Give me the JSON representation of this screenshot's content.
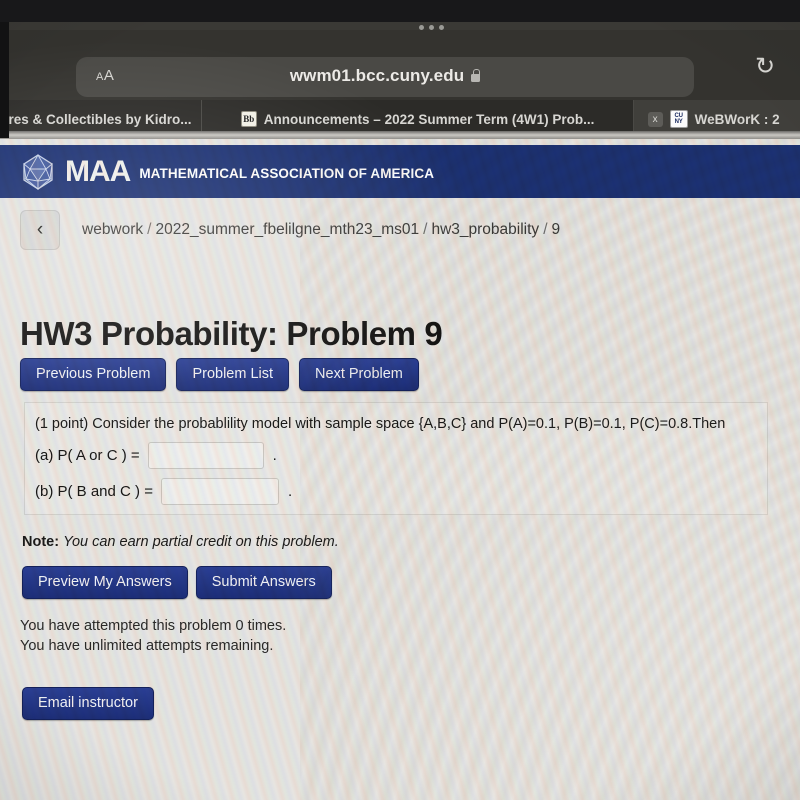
{
  "browser": {
    "tab_overflow_icon": "ellipsis-icon",
    "text_size_button": "AA",
    "url": "wwm01.bcc.cuny.edu",
    "lock_icon": "lock-icon",
    "reload_icon": "reload-icon",
    "tabs": [
      {
        "title": "gures & Collectibles by Kidro...",
        "favicon": "none",
        "active": false,
        "has_close": false
      },
      {
        "title": "Announcements – 2022 Summer Term (4W1) Prob...",
        "favicon": "blackboard-icon",
        "favicon_text": "Bb",
        "active": false,
        "has_close": false
      },
      {
        "title": "WeBWorK : 2",
        "favicon": "cuny-icon",
        "favicon_line1": "CU",
        "favicon_line2": "NY",
        "active": true,
        "has_close": true,
        "close_label": "x"
      }
    ]
  },
  "site_header": {
    "logo_name": "maa-icosahedron-logo",
    "brand": "MAA",
    "brand_subtitle": "MATHEMATICAL ASSOCIATION OF AMERICA",
    "banner_color": "#1c3173"
  },
  "breadcrumb": {
    "back_icon": "chevron-left-icon",
    "separator": "/",
    "items": [
      "webwork",
      "2022_summer_fbelilgne_mth23_ms01",
      "hw3_probability",
      "9"
    ]
  },
  "main": {
    "title": "HW3 Probability: Problem 9",
    "nav_buttons": [
      "Previous Problem",
      "Problem List",
      "Next Problem"
    ],
    "problem": {
      "statement": "(1 point) Consider the probablility model with sample space {A,B,C} and P(A)=0.1, P(B)=0.1, P(C)=0.8.Then",
      "parts": [
        {
          "label": "(a) P( A or C ) =",
          "value": "",
          "placeholder": "",
          "trailing": "."
        },
        {
          "label": "(b) P( B and C ) =",
          "value": "",
          "placeholder": "",
          "trailing": "."
        }
      ]
    },
    "note_label": "Note:",
    "note_text": "You can earn partial credit on this problem.",
    "answer_buttons": [
      "Preview My Answers",
      "Submit Answers"
    ],
    "attempts_line1": "You have attempted this problem 0 times.",
    "attempts_line2": "You have unlimited attempts remaining.",
    "email_button": "Email instructor"
  },
  "theme": {
    "button_blue": "#1d2e78",
    "banner_blue": "#1c3173",
    "page_bg": "#e7e5e2",
    "chrome_bg": "#34332f"
  }
}
